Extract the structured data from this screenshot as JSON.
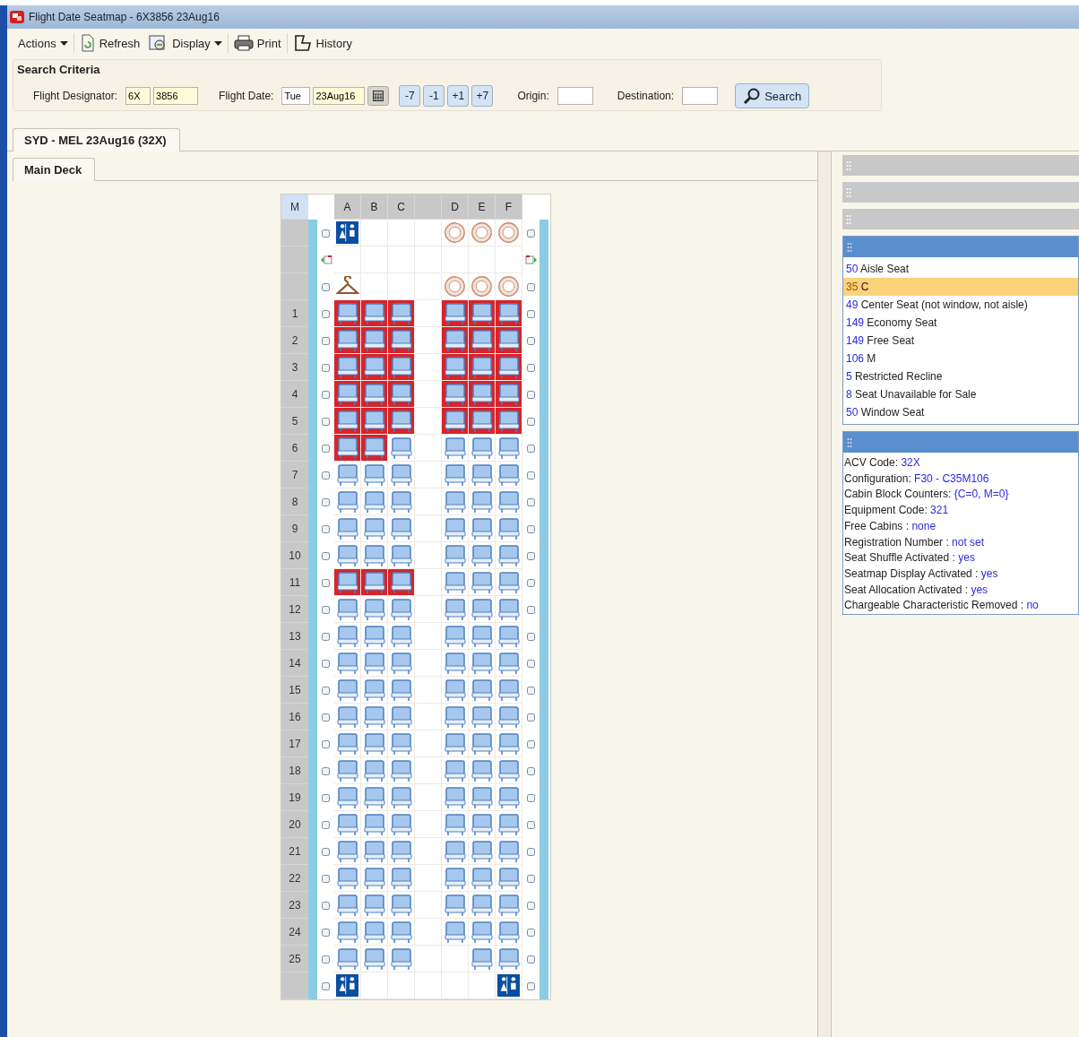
{
  "window": {
    "title": "Flight Date Seatmap - 6X3856  23Aug16"
  },
  "toolbar": [
    {
      "label": "Actions",
      "kind": "menu"
    },
    {
      "label": "Refresh",
      "kind": "refresh"
    },
    {
      "label": "Display",
      "kind": "display"
    },
    {
      "label": "Print",
      "kind": "print"
    },
    {
      "label": "History",
      "kind": "history"
    }
  ],
  "search_criteria": {
    "title": "Search Criteria",
    "flight_designator_label": "Flight Designator:",
    "carrier": "6X",
    "flight_number": "3856",
    "flight_date_label": "Flight Date:",
    "weekday": "Tue",
    "date": "23Aug16",
    "day_buttons": [
      "-7",
      "-1",
      "+1",
      "+7"
    ],
    "origin_label": "Origin:",
    "destination_label": "Destination:",
    "search_button": "Search"
  },
  "flight_tabs": [
    {
      "label": "SYD - MEL  23Aug16 (32X)",
      "selected": true
    }
  ],
  "deck_tabs": [
    {
      "label": "Main Deck",
      "selected": true
    }
  ],
  "seatmap": {
    "cabin_label": "M",
    "columns": [
      "A",
      "B",
      "C",
      "D",
      "E",
      "F"
    ],
    "rows": [
      {
        "number": "",
        "exit": false,
        "cells": [
          {
            "kind": "lavatory"
          },
          {
            "kind": "empty"
          },
          {
            "kind": "empty"
          },
          {
            "kind": "galley"
          },
          {
            "kind": "galley"
          },
          {
            "kind": "galley"
          }
        ]
      },
      {
        "number": "",
        "exit": true,
        "cells": [
          {
            "kind": "empty"
          },
          {
            "kind": "empty"
          },
          {
            "kind": "empty"
          },
          {
            "kind": "empty"
          },
          {
            "kind": "empty"
          },
          {
            "kind": "empty"
          }
        ]
      },
      {
        "number": "",
        "exit": false,
        "cells": [
          {
            "kind": "closet"
          },
          {
            "kind": "empty"
          },
          {
            "kind": "empty"
          },
          {
            "kind": "galley"
          },
          {
            "kind": "galley"
          },
          {
            "kind": "galley"
          }
        ]
      },
      {
        "number": "1",
        "exit": false,
        "cells": [
          {
            "kind": "seat",
            "blocked": true
          },
          {
            "kind": "seat",
            "blocked": true
          },
          {
            "kind": "seat",
            "blocked": true
          },
          {
            "kind": "seat",
            "blocked": true
          },
          {
            "kind": "seat",
            "blocked": true
          },
          {
            "kind": "seat",
            "blocked": true
          }
        ]
      },
      {
        "number": "2",
        "exit": false,
        "cells": [
          {
            "kind": "seat",
            "blocked": true
          },
          {
            "kind": "seat",
            "blocked": true
          },
          {
            "kind": "seat",
            "blocked": true
          },
          {
            "kind": "seat",
            "blocked": true
          },
          {
            "kind": "seat",
            "blocked": true
          },
          {
            "kind": "seat",
            "blocked": true
          }
        ]
      },
      {
        "number": "3",
        "exit": false,
        "cells": [
          {
            "kind": "seat",
            "blocked": true
          },
          {
            "kind": "seat",
            "blocked": true
          },
          {
            "kind": "seat",
            "blocked": true
          },
          {
            "kind": "seat",
            "blocked": true
          },
          {
            "kind": "seat",
            "blocked": true
          },
          {
            "kind": "seat",
            "blocked": true
          }
        ]
      },
      {
        "number": "4",
        "exit": false,
        "cells": [
          {
            "kind": "seat",
            "blocked": true
          },
          {
            "kind": "seat",
            "blocked": true
          },
          {
            "kind": "seat",
            "blocked": true
          },
          {
            "kind": "seat",
            "blocked": true
          },
          {
            "kind": "seat",
            "blocked": true
          },
          {
            "kind": "seat",
            "blocked": true
          }
        ]
      },
      {
        "number": "5",
        "exit": false,
        "cells": [
          {
            "kind": "seat",
            "blocked": true
          },
          {
            "kind": "seat",
            "blocked": true
          },
          {
            "kind": "seat",
            "blocked": true
          },
          {
            "kind": "seat",
            "blocked": true
          },
          {
            "kind": "seat",
            "blocked": true
          },
          {
            "kind": "seat",
            "blocked": true
          }
        ]
      },
      {
        "number": "6",
        "exit": false,
        "cells": [
          {
            "kind": "seat",
            "blocked": true
          },
          {
            "kind": "seat",
            "blocked": true
          },
          {
            "kind": "seat",
            "blocked": false
          },
          {
            "kind": "seat",
            "blocked": false
          },
          {
            "kind": "seat",
            "blocked": false
          },
          {
            "kind": "seat",
            "blocked": false
          }
        ]
      },
      {
        "number": "7",
        "exit": false,
        "cells": [
          {
            "kind": "seat",
            "blocked": false
          },
          {
            "kind": "seat",
            "blocked": false
          },
          {
            "kind": "seat",
            "blocked": false
          },
          {
            "kind": "seat",
            "blocked": false
          },
          {
            "kind": "seat",
            "blocked": false
          },
          {
            "kind": "seat",
            "blocked": false
          }
        ]
      },
      {
        "number": "8",
        "exit": false,
        "cells": [
          {
            "kind": "seat",
            "blocked": false
          },
          {
            "kind": "seat",
            "blocked": false
          },
          {
            "kind": "seat",
            "blocked": false
          },
          {
            "kind": "seat",
            "blocked": false
          },
          {
            "kind": "seat",
            "blocked": false
          },
          {
            "kind": "seat",
            "blocked": false
          }
        ]
      },
      {
        "number": "9",
        "exit": false,
        "cells": [
          {
            "kind": "seat",
            "blocked": false
          },
          {
            "kind": "seat",
            "blocked": false
          },
          {
            "kind": "seat",
            "blocked": false
          },
          {
            "kind": "seat",
            "blocked": false
          },
          {
            "kind": "seat",
            "blocked": false
          },
          {
            "kind": "seat",
            "blocked": false
          }
        ]
      },
      {
        "number": "10",
        "exit": false,
        "cells": [
          {
            "kind": "seat",
            "blocked": false
          },
          {
            "kind": "seat",
            "blocked": false
          },
          {
            "kind": "seat",
            "blocked": false
          },
          {
            "kind": "seat",
            "blocked": false
          },
          {
            "kind": "seat",
            "blocked": false
          },
          {
            "kind": "seat",
            "blocked": false
          }
        ]
      },
      {
        "number": "11",
        "exit": false,
        "cells": [
          {
            "kind": "seat",
            "blocked": true
          },
          {
            "kind": "seat",
            "blocked": true
          },
          {
            "kind": "seat",
            "blocked": true
          },
          {
            "kind": "seat",
            "blocked": false
          },
          {
            "kind": "seat",
            "blocked": false
          },
          {
            "kind": "seat",
            "blocked": false
          }
        ]
      },
      {
        "number": "12",
        "exit": false,
        "cells": [
          {
            "kind": "seat",
            "blocked": false
          },
          {
            "kind": "seat",
            "blocked": false
          },
          {
            "kind": "seat",
            "blocked": false
          },
          {
            "kind": "seat",
            "blocked": false
          },
          {
            "kind": "seat",
            "blocked": false
          },
          {
            "kind": "seat",
            "blocked": false
          }
        ]
      },
      {
        "number": "13",
        "exit": false,
        "cells": [
          {
            "kind": "seat",
            "blocked": false
          },
          {
            "kind": "seat",
            "blocked": false
          },
          {
            "kind": "seat",
            "blocked": false
          },
          {
            "kind": "seat",
            "blocked": false
          },
          {
            "kind": "seat",
            "blocked": false
          },
          {
            "kind": "seat",
            "blocked": false
          }
        ]
      },
      {
        "number": "14",
        "exit": false,
        "cells": [
          {
            "kind": "seat",
            "blocked": false
          },
          {
            "kind": "seat",
            "blocked": false
          },
          {
            "kind": "seat",
            "blocked": false
          },
          {
            "kind": "seat",
            "blocked": false
          },
          {
            "kind": "seat",
            "blocked": false
          },
          {
            "kind": "seat",
            "blocked": false
          }
        ]
      },
      {
        "number": "15",
        "exit": false,
        "cells": [
          {
            "kind": "seat",
            "blocked": false
          },
          {
            "kind": "seat",
            "blocked": false
          },
          {
            "kind": "seat",
            "blocked": false
          },
          {
            "kind": "seat",
            "blocked": false
          },
          {
            "kind": "seat",
            "blocked": false
          },
          {
            "kind": "seat",
            "blocked": false
          }
        ]
      },
      {
        "number": "16",
        "exit": false,
        "cells": [
          {
            "kind": "seat",
            "blocked": false
          },
          {
            "kind": "seat",
            "blocked": false
          },
          {
            "kind": "seat",
            "blocked": false
          },
          {
            "kind": "seat",
            "blocked": false
          },
          {
            "kind": "seat",
            "blocked": false
          },
          {
            "kind": "seat",
            "blocked": false
          }
        ]
      },
      {
        "number": "17",
        "exit": false,
        "cells": [
          {
            "kind": "seat",
            "blocked": false
          },
          {
            "kind": "seat",
            "blocked": false
          },
          {
            "kind": "seat",
            "blocked": false
          },
          {
            "kind": "seat",
            "blocked": false
          },
          {
            "kind": "seat",
            "blocked": false
          },
          {
            "kind": "seat",
            "blocked": false
          }
        ]
      },
      {
        "number": "18",
        "exit": false,
        "cells": [
          {
            "kind": "seat",
            "blocked": false
          },
          {
            "kind": "seat",
            "blocked": false
          },
          {
            "kind": "seat",
            "blocked": false
          },
          {
            "kind": "seat",
            "blocked": false
          },
          {
            "kind": "seat",
            "blocked": false
          },
          {
            "kind": "seat",
            "blocked": false
          }
        ]
      },
      {
        "number": "19",
        "exit": false,
        "cells": [
          {
            "kind": "seat",
            "blocked": false
          },
          {
            "kind": "seat",
            "blocked": false
          },
          {
            "kind": "seat",
            "blocked": false
          },
          {
            "kind": "seat",
            "blocked": false
          },
          {
            "kind": "seat",
            "blocked": false
          },
          {
            "kind": "seat",
            "blocked": false
          }
        ]
      },
      {
        "number": "20",
        "exit": false,
        "cells": [
          {
            "kind": "seat",
            "blocked": false
          },
          {
            "kind": "seat",
            "blocked": false
          },
          {
            "kind": "seat",
            "blocked": false
          },
          {
            "kind": "seat",
            "blocked": false
          },
          {
            "kind": "seat",
            "blocked": false
          },
          {
            "kind": "seat",
            "blocked": false
          }
        ]
      },
      {
        "number": "21",
        "exit": false,
        "cells": [
          {
            "kind": "seat",
            "blocked": false
          },
          {
            "kind": "seat",
            "blocked": false
          },
          {
            "kind": "seat",
            "blocked": false
          },
          {
            "kind": "seat",
            "blocked": false
          },
          {
            "kind": "seat",
            "blocked": false
          },
          {
            "kind": "seat",
            "blocked": false
          }
        ]
      },
      {
        "number": "22",
        "exit": false,
        "cells": [
          {
            "kind": "seat",
            "blocked": false
          },
          {
            "kind": "seat",
            "blocked": false
          },
          {
            "kind": "seat",
            "blocked": false
          },
          {
            "kind": "seat",
            "blocked": false
          },
          {
            "kind": "seat",
            "blocked": false
          },
          {
            "kind": "seat",
            "blocked": false
          }
        ]
      },
      {
        "number": "23",
        "exit": false,
        "cells": [
          {
            "kind": "seat",
            "blocked": false
          },
          {
            "kind": "seat",
            "blocked": false
          },
          {
            "kind": "seat",
            "blocked": false
          },
          {
            "kind": "seat",
            "blocked": false
          },
          {
            "kind": "seat",
            "blocked": false
          },
          {
            "kind": "seat",
            "blocked": false
          }
        ]
      },
      {
        "number": "24",
        "exit": false,
        "cells": [
          {
            "kind": "seat",
            "blocked": false
          },
          {
            "kind": "seat",
            "blocked": false
          },
          {
            "kind": "seat",
            "blocked": false
          },
          {
            "kind": "seat",
            "blocked": false
          },
          {
            "kind": "seat",
            "blocked": false
          },
          {
            "kind": "seat",
            "blocked": false
          }
        ]
      },
      {
        "number": "25",
        "exit": false,
        "cells": [
          {
            "kind": "seat",
            "blocked": false
          },
          {
            "kind": "seat",
            "blocked": false
          },
          {
            "kind": "seat",
            "blocked": false
          },
          {
            "kind": "empty"
          },
          {
            "kind": "seat",
            "blocked": false
          },
          {
            "kind": "seat",
            "blocked": false
          }
        ]
      },
      {
        "number": "",
        "exit": false,
        "cells": [
          {
            "kind": "lavatory"
          },
          {
            "kind": "empty"
          },
          {
            "kind": "empty"
          },
          {
            "kind": "empty"
          },
          {
            "kind": "empty"
          },
          {
            "kind": "lavatory"
          }
        ]
      }
    ]
  },
  "characteristics": [
    {
      "count": "50",
      "label": "Aisle Seat",
      "selected": false
    },
    {
      "count": "35",
      "label": "C",
      "selected": true
    },
    {
      "count": "49",
      "label": "Center Seat (not window, not aisle)",
      "selected": false
    },
    {
      "count": "149",
      "label": "Economy Seat",
      "selected": false
    },
    {
      "count": "149",
      "label": "Free Seat",
      "selected": false
    },
    {
      "count": "106",
      "label": "M",
      "selected": false
    },
    {
      "count": "5",
      "label": "Restricted Recline",
      "selected": false
    },
    {
      "count": "8",
      "label": "Seat Unavailable for Sale",
      "selected": false
    },
    {
      "count": "50",
      "label": "Window Seat",
      "selected": false
    }
  ],
  "details": [
    {
      "label": "ACV Code:",
      "value": "32X"
    },
    {
      "label": "Configuration:",
      "value": "F30 - C35M106"
    },
    {
      "label": "Cabin Block Counters:",
      "value": "{C=0, M=0}"
    },
    {
      "label": "Equipment Code:",
      "value": "321"
    },
    {
      "label": "Free Cabins :",
      "value": "none"
    },
    {
      "label": "Registration Number :",
      "value": "not set"
    },
    {
      "label": "Seat Shuffle Activated :",
      "value": "yes"
    },
    {
      "label": "Seatmap Display Activated :",
      "value": "yes"
    },
    {
      "label": "Seat Allocation Activated :",
      "value": "yes"
    },
    {
      "label": "Chargeable Characteristic Removed :",
      "value": "no"
    }
  ]
}
